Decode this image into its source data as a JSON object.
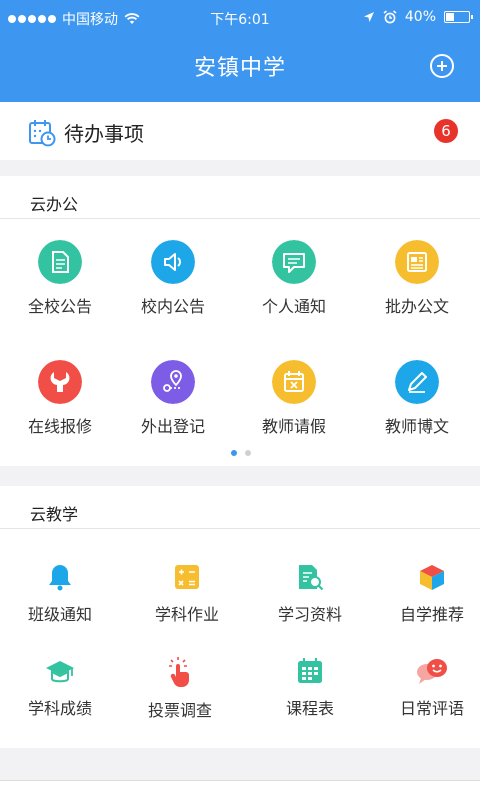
{
  "status_bar": {
    "carrier": "中国移动",
    "time": "下午6:01",
    "battery_percent": "40%",
    "battery_level": 0.4
  },
  "nav": {
    "title": "安镇中学",
    "add_icon": "plus-circle-icon"
  },
  "todo": {
    "label": "待办事项",
    "badge": "6",
    "icon": "calendar-clock-icon"
  },
  "office": {
    "title": "云办公",
    "items": [
      {
        "label": "全校公告",
        "icon": "document-icon",
        "color": "#33c3a0"
      },
      {
        "label": "校内公告",
        "icon": "speaker-icon",
        "color": "#1ea7e8"
      },
      {
        "label": "个人通知",
        "icon": "message-icon",
        "color": "#33c3a0"
      },
      {
        "label": "批办公文",
        "icon": "newspaper-icon",
        "color": "#f6be2e"
      },
      {
        "label": "在线报修",
        "icon": "wrench-icon",
        "color": "#f04e46"
      },
      {
        "label": "外出登记",
        "icon": "location-icon",
        "color": "#7d5ce6"
      },
      {
        "label": "教师请假",
        "icon": "calendar-x-icon",
        "color": "#f6be2e"
      },
      {
        "label": "教师博文",
        "icon": "pencil-icon",
        "color": "#1ea7e8"
      }
    ],
    "page_active_color": "#3d97f0",
    "page_inactive_color": "#d0d0d0"
  },
  "teaching": {
    "title": "云教学",
    "items": [
      {
        "label": "班级通知",
        "icon": "bell-icon"
      },
      {
        "label": "学科作业",
        "icon": "calculator-icon"
      },
      {
        "label": "学习资料",
        "icon": "document-search-icon"
      },
      {
        "label": "自学推荐",
        "icon": "cube-icon"
      },
      {
        "label": "学科成绩",
        "icon": "graduation-cap-icon"
      },
      {
        "label": "投票调查",
        "icon": "hand-tap-icon"
      },
      {
        "label": "课程表",
        "icon": "schedule-icon"
      },
      {
        "label": "日常评语",
        "icon": "chat-bubbles-icon"
      }
    ]
  }
}
